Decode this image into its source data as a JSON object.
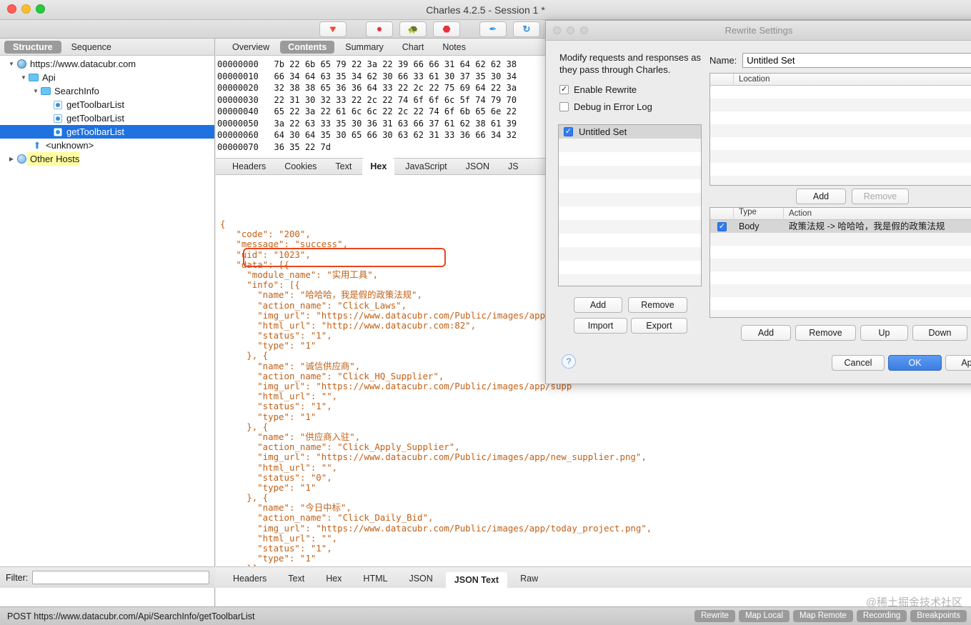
{
  "window": {
    "title": "Charles 4.2.5 - Session 1 *",
    "traffic_lights": [
      "close",
      "minimize",
      "zoom"
    ]
  },
  "toolbar": {
    "buttons": [
      {
        "name": "clear-icon",
        "glyph": "🔽"
      },
      {
        "name": "record-icon",
        "glyph": "⏺"
      },
      {
        "name": "throttle-icon",
        "glyph": "🐢"
      },
      {
        "name": "breakpoints-icon",
        "glyph": "⛔"
      },
      {
        "name": "compose-icon",
        "glyph": "✒"
      },
      {
        "name": "repeat-icon",
        "glyph": "C"
      }
    ]
  },
  "sidebar": {
    "tabs": [
      {
        "label": "Structure",
        "selected": true
      },
      {
        "label": "Sequence",
        "selected": false
      }
    ],
    "tree": [
      {
        "label": "https://www.datacubr.com",
        "indent": 0,
        "disclosure": "▼",
        "icon": "globe-icon",
        "selected": false,
        "highlight": false
      },
      {
        "label": "Api",
        "indent": 1,
        "disclosure": "▼",
        "icon": "folder-icon",
        "selected": false,
        "highlight": false
      },
      {
        "label": "SearchInfo",
        "indent": 2,
        "disclosure": "▼",
        "icon": "folder-icon",
        "selected": false,
        "highlight": false
      },
      {
        "label": "getToolbarList",
        "indent": 3,
        "disclosure": "",
        "icon": "request-icon",
        "selected": false,
        "highlight": false
      },
      {
        "label": "getToolbarList",
        "indent": 3,
        "disclosure": "",
        "icon": "request-icon",
        "selected": false,
        "highlight": false
      },
      {
        "label": "getToolbarList",
        "indent": 3,
        "disclosure": "",
        "icon": "request-icon",
        "selected": true,
        "highlight": false
      },
      {
        "label": "<unknown>",
        "indent": 2,
        "disclosure": "",
        "icon": "up-arrow-icon",
        "selected": false,
        "highlight": false
      },
      {
        "label": "Other Hosts",
        "indent": 0,
        "disclosure": "▶",
        "icon": "hosts-icon",
        "selected": false,
        "highlight": true
      }
    ],
    "filter_label": "Filter:",
    "filter_value": "",
    "filter_placeholder": ""
  },
  "main": {
    "top_tabs": [
      {
        "label": "Overview",
        "selected": false
      },
      {
        "label": "Contents",
        "selected": true
      },
      {
        "label": "Summary",
        "selected": false
      },
      {
        "label": "Chart",
        "selected": false
      },
      {
        "label": "Notes",
        "selected": false
      }
    ],
    "hex_lines": [
      {
        "offset": "00000000",
        "bytes": "7b 22 6b 65 79 22 3a 22 39 66 66 31 64 62 62 38"
      },
      {
        "offset": "00000010",
        "bytes": "66 34 64 63 35 34 62 30 66 33 61 30 37 35 30 34"
      },
      {
        "offset": "00000020",
        "bytes": "32 38 38 65 36 36 64 33 22 2c 22 75 69 64 22 3a"
      },
      {
        "offset": "00000030",
        "bytes": "22 31 30 32 33 22 2c 22 74 6f 6f 6c 5f 74 79 70"
      },
      {
        "offset": "00000040",
        "bytes": "65 22 3a 22 61 6c 6c 22 2c 22 74 6f 6b 65 6e 22"
      },
      {
        "offset": "00000050",
        "bytes": "3a 22 63 33 35 30 36 31 63 66 37 61 62 38 61 39"
      },
      {
        "offset": "00000060",
        "bytes": "64 30 64 35 30 65 66 30 63 62 31 33 36 66 34 32"
      },
      {
        "offset": "00000070",
        "bytes": "36 35 22 7d"
      }
    ],
    "mid_tabs": [
      {
        "label": "Headers",
        "selected": false
      },
      {
        "label": "Cookies",
        "selected": false
      },
      {
        "label": "Text",
        "selected": false
      },
      {
        "label": "Hex",
        "selected": true
      },
      {
        "label": "JavaScript",
        "selected": false
      },
      {
        "label": "JSON",
        "selected": false
      },
      {
        "label": "JS",
        "selected": false
      }
    ],
    "json_lines": [
      "{",
      "   \"code\": \"200\",",
      "   \"message\": \"success\",",
      "   \"uid\": \"1023\",",
      "   \"data\": [{",
      "     \"module_name\": \"实用工具\",",
      "     \"info\": [{",
      "       \"name\": \"哈哈哈，我是假的政策法规\",",
      "       \"action_name\": \"Click_Laws\",",
      "       \"img_url\": \"https://www.datacubr.com/Public/images/app/laws",
      "       \"html_url\": \"http://www.datacubr.com:82\",",
      "       \"status\": \"1\",",
      "       \"type\": \"1\"",
      "     }, {",
      "       \"name\": \"诚信供应商\",",
      "       \"action_name\": \"Click_HQ_Supplier\",",
      "       \"img_url\": \"https://www.datacubr.com/Public/images/app/supp",
      "       \"html_url\": \"\",",
      "       \"status\": \"1\",",
      "       \"type\": \"1\"",
      "     }, {",
      "       \"name\": \"供应商入驻\",",
      "       \"action_name\": \"Click_Apply_Supplier\",",
      "       \"img_url\": \"https://www.datacubr.com/Public/images/app/new_supplier.png\",",
      "       \"html_url\": \"\",",
      "       \"status\": \"0\",",
      "       \"type\": \"1\"",
      "     }, {",
      "       \"name\": \"今日中标\",",
      "       \"action_name\": \"Click_Daily_Bid\",",
      "       \"img_url\": \"https://www.datacubr.com/Public/images/app/today_project.png\",",
      "       \"html_url\": \"\",",
      "       \"status\": \"1\",",
      "       \"type\": \"1\"",
      "     }]",
      "   }]",
      "}"
    ],
    "bottom_tabs": [
      {
        "label": "Headers",
        "selected": false
      },
      {
        "label": "Text",
        "selected": false
      },
      {
        "label": "Hex",
        "selected": false
      },
      {
        "label": "HTML",
        "selected": false
      },
      {
        "label": "JSON",
        "selected": false
      },
      {
        "label": "JSON Text",
        "selected": true
      },
      {
        "label": "Raw",
        "selected": false
      }
    ]
  },
  "dialog": {
    "title": "Rewrite Settings",
    "description": "Modify requests and responses as they pass through Charles.",
    "checkboxes": [
      {
        "label": "Enable Rewrite",
        "checked": true
      },
      {
        "label": "Debug in Error Log",
        "checked": false
      }
    ],
    "sets": [
      {
        "label": "Untitled Set",
        "checked": true,
        "selected": true
      }
    ],
    "set_buttons": [
      "Add",
      "Remove",
      "Import",
      "Export"
    ],
    "help_glyph": "?",
    "name_label": "Name:",
    "name_value": "Untitled Set",
    "location_header": "Location",
    "location_rows": [],
    "location_buttons": [
      {
        "label": "Add",
        "enabled": true
      },
      {
        "label": "Remove",
        "enabled": false
      }
    ],
    "action_headers": [
      "Type",
      "Action"
    ],
    "action_rows": [
      {
        "checked": true,
        "type": "Body",
        "action": "政策法规 -> 哈哈哈，我是假的政策法规",
        "selected": true
      }
    ],
    "action_buttons": [
      "Add",
      "Remove",
      "Up",
      "Down"
    ],
    "footer_buttons": [
      "Cancel",
      "OK",
      "Ap"
    ]
  },
  "status": {
    "request_line": "POST https://www.datacubr.com/Api/SearchInfo/getToolbarList",
    "pills": [
      "Rewrite",
      "Map Local",
      "Map Remote",
      "Recording",
      "Breakpoints"
    ],
    "watermark": "@稀土掘金技术社区"
  },
  "colors": {
    "selection_blue": "#1f72e0",
    "json_orange": "#c26016",
    "highlight_box_red": "#e8471d",
    "highlight_yellow": "#ffffa0"
  }
}
